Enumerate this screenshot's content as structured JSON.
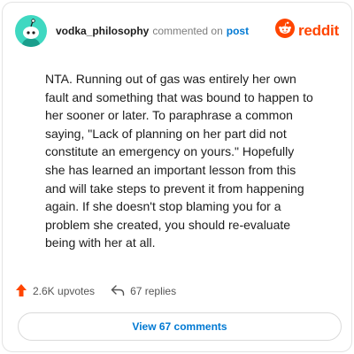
{
  "header": {
    "username": "vodka_philosophy",
    "action": "commented on",
    "target": "post",
    "brand": "reddit"
  },
  "icons": {
    "avatar": "snoo-avatar-icon",
    "brand": "reddit-logo-icon",
    "upvote": "upvote-arrow-icon",
    "reply": "reply-arrow-icon"
  },
  "colors": {
    "brand": "#ff4500",
    "link": "#0079d3",
    "avatar_bg": "#3fd8c1"
  },
  "comment": {
    "lines": [
      "NTA. Running out of gas was entirely her own",
      "fault and something that was bound to happen to",
      "her sooner or later. To paraphrase a common",
      "saying, \"Lack of planning on her part did not",
      "constitute an emergency on yours.\" Hopefully",
      "she has learned an important lesson from this",
      "and will take steps to prevent it from happening",
      "again. If she doesn't stop blaming you for a",
      "problem she created, you should re-evaluate",
      "being with her at all."
    ]
  },
  "actions": {
    "upvotes": "2.6K upvotes",
    "replies": "67 replies"
  },
  "footer": {
    "view_comments": "View 67 comments"
  }
}
